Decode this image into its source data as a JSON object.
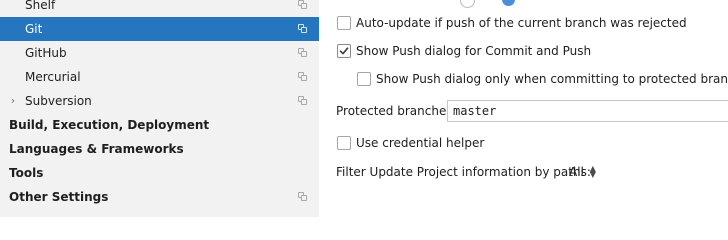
{
  "sidebar": {
    "items": [
      {
        "label": "Shelf",
        "level": 1
      },
      {
        "label": "Git",
        "level": 1,
        "selected": true
      },
      {
        "label": "GitHub",
        "level": 1
      },
      {
        "label": "Mercurial",
        "level": 1
      },
      {
        "label": "Subversion",
        "level": 1,
        "expandable": true
      },
      {
        "label": "Build, Execution, Deployment",
        "bold": true
      },
      {
        "label": "Languages & Frameworks",
        "bold": true
      },
      {
        "label": "Tools",
        "bold": true
      },
      {
        "label": "Other Settings",
        "bold": true
      }
    ],
    "icons": {
      "chevron": "chevron-right-icon",
      "project_scope": "copy-icon"
    }
  },
  "settings": {
    "auto_update_label": "Auto-update if push of the current branch was rejected",
    "auto_update_checked": false,
    "show_push_dialog_label": "Show Push dialog for Commit and Push",
    "show_push_dialog_checked": true,
    "protected_only_label": "Show Push dialog only when committing to protected branches",
    "protected_only_checked": false,
    "protected_branches_label": "Protected branches:",
    "protected_branches_value": "master",
    "credential_helper_label": "Use credential helper",
    "credential_helper_checked": false,
    "filter_label": "Filter Update Project information by paths:",
    "filter_value": "All"
  },
  "colors": {
    "selection": "#2675bf",
    "sidebar_bg": "#f2f2f2",
    "check_mark": "#3a3a3a"
  }
}
